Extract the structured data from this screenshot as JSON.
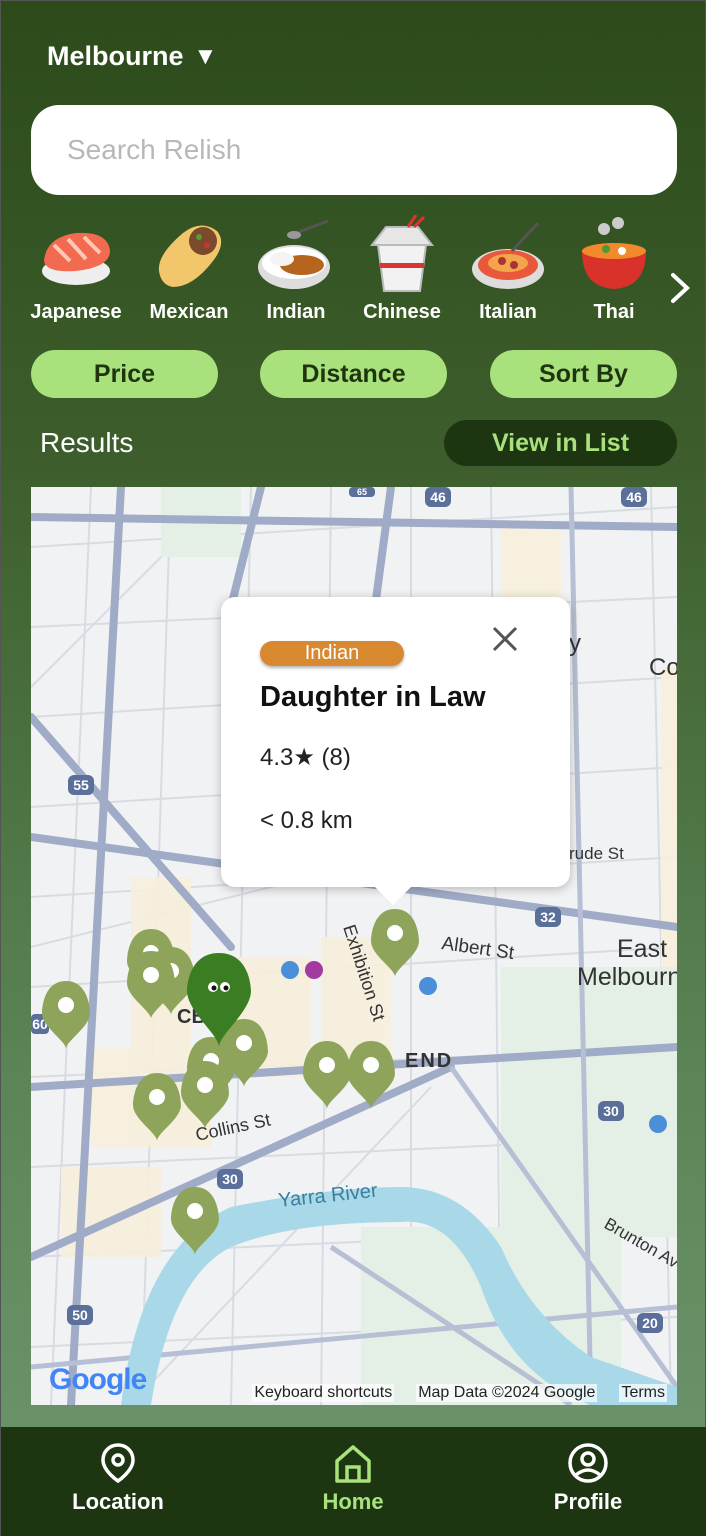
{
  "header": {
    "city": "Melbourne",
    "caret": "▼"
  },
  "search": {
    "placeholder": "Search Relish",
    "value": ""
  },
  "cuisines": [
    {
      "label": "Japanese",
      "icon": "sushi-icon"
    },
    {
      "label": "Mexican",
      "icon": "burrito-icon"
    },
    {
      "label": "Indian",
      "icon": "curry-icon"
    },
    {
      "label": "Chinese",
      "icon": "takeout-box-icon"
    },
    {
      "label": "Italian",
      "icon": "spaghetti-icon"
    },
    {
      "label": "Thai",
      "icon": "stew-pot-icon"
    }
  ],
  "filters": {
    "price": "Price",
    "distance": "Distance",
    "sort": "Sort By"
  },
  "results": {
    "title": "Results",
    "view_list": "View in List"
  },
  "popup": {
    "tag": "Indian",
    "name": "Daughter in Law",
    "rating": "4.3★ (8)",
    "distance": "< 0.8 km"
  },
  "map": {
    "labels": {
      "albert_st": "Albert St",
      "east_melbourne": "East",
      "east_melbourne2": "Melbourn",
      "exhibition_st": "Exhibition St",
      "end": "END",
      "collins_st": "Collins St",
      "yarra_river": "Yarra River",
      "brunton": "Brunton Av",
      "gertrude": "rude St",
      "cbd": "CB",
      "co": "Co",
      "y": "y"
    },
    "shields": [
      "46",
      "46",
      "55",
      "32",
      "30",
      "30",
      "50",
      "20",
      "60",
      "65"
    ],
    "attribution": {
      "logo": "Google",
      "shortcuts": "Keyboard shortcuts",
      "data": "Map Data ©2024 Google",
      "terms": "Terms"
    }
  },
  "nav": {
    "location": "Location",
    "home": "Home",
    "profile": "Profile"
  },
  "colors": {
    "accent": "#a9e27d",
    "dark": "#1d3510",
    "pin": "#8fa45b",
    "selected_pin": "#3b7d22",
    "tag": "#d8892f"
  }
}
